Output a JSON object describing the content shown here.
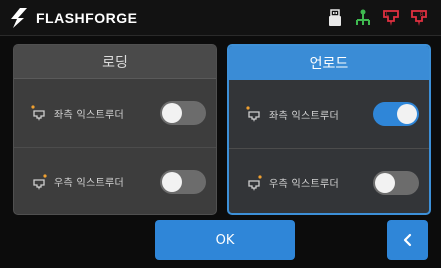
{
  "header": {
    "brand": "FLASHFORGE",
    "icons": [
      "usb-icon",
      "network-icon",
      "extruder-left-icon",
      "extruder-right-icon"
    ]
  },
  "panels": [
    {
      "title": "로딩",
      "selected": false,
      "rows": [
        {
          "label": "좌측 익스트루더",
          "on": false
        },
        {
          "label": "우측 익스트루더",
          "on": false
        }
      ]
    },
    {
      "title": "언로드",
      "selected": true,
      "rows": [
        {
          "label": "좌측 익스트루더",
          "on": true
        },
        {
          "label": "우측 익스트루더",
          "on": false
        }
      ]
    }
  ],
  "buttons": {
    "ok": "OK",
    "back_icon": "chevron-left-icon"
  },
  "colors": {
    "accent": "#2f86d8",
    "toggle_off": "#6c6c6c",
    "extruder_icon": "#e03040",
    "network_icon": "#3fb950"
  }
}
